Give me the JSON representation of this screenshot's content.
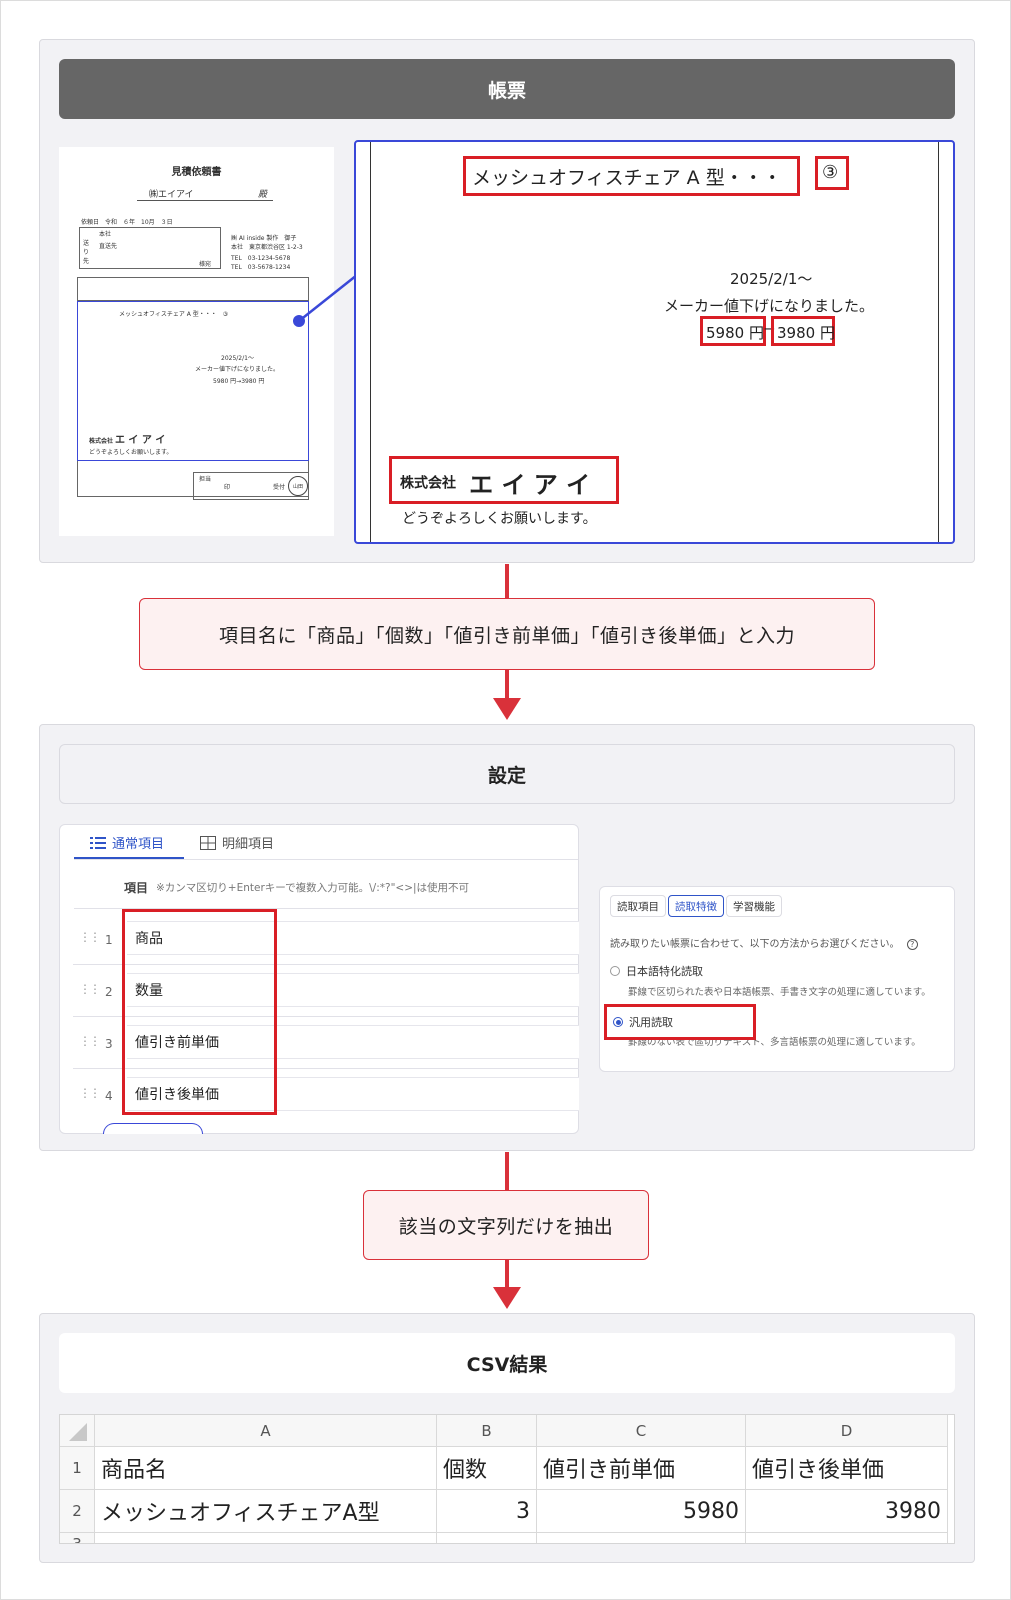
{
  "document_panel": {
    "title": "帳票",
    "thumbnail": {
      "title": "見積依頼書",
      "customer": "㈱エイアイ",
      "honorific": "殿",
      "date_line": "依頼日　令和　６年　10月　３日",
      "addr1": "本社",
      "addr2": "直送先",
      "addr_label": "送り先",
      "sama": "様宛",
      "sender_company": "㈱ AI inside 製作　御子",
      "sender_addr": "本社　東京都渋谷区 1-2-3",
      "tel1": "TEL　03-1234-5678",
      "tel2": "TEL　03-5678-1234",
      "item": "メッシュオフィスチェア A 型・・・　③",
      "date": "2025/2/1〜",
      "notice": "メーカー値下げになりました。",
      "price": "5980 円→3980 円",
      "company_prefix": "株式会社",
      "company_name": "エ イ ア イ",
      "closing": "どうぞよろしくお願いします。",
      "stamp_cells": [
        "担当",
        "印",
        "受付",
        "山田"
      ]
    },
    "zoom": {
      "item": "メッシュオフィスチェア A 型・・・",
      "qty": "③",
      "date": "2025/2/1〜",
      "notice": "メーカー値下げになりました。",
      "price_before": "5980 円",
      "price_after": "3980 円",
      "arrow": "→",
      "company_prefix": "株式会社",
      "company_name": "エ イ ア イ",
      "closing": "どうぞよろしくお願いします。"
    }
  },
  "step1": "項目名に「商品」「個数」「値引き前単価」「値引き後単価」と入力",
  "settings_panel": {
    "title": "設定",
    "tabs": [
      {
        "label": "通常項目",
        "active": true
      },
      {
        "label": "明細項目",
        "active": false
      }
    ],
    "column_header": "項目",
    "column_note": "※カンマ区切り+Enterキーで複数入力可能。\\/:*?\"<>|は使用不可",
    "rows": [
      {
        "num": "1",
        "value": "商品"
      },
      {
        "num": "2",
        "value": "数量"
      },
      {
        "num": "3",
        "value": "値引き前単価"
      },
      {
        "num": "4",
        "value": "値引き後単価"
      }
    ],
    "reading": {
      "tabs": [
        "読取項目",
        "読取特徴",
        "学習機能"
      ],
      "active_tab": "読取特徴",
      "instruction": "読み取りたい帳票に合わせて、以下の方法からお選びください。",
      "help_icon": "?",
      "options": [
        {
          "label": "日本語特化読取",
          "desc": "罫線で区切られた表や日本語帳票、手書き文字の処理に適しています。",
          "selected": false
        },
        {
          "label": "汎用読取",
          "desc": "罫線のない表で區切りテキスト、多言語帳票の処理に適しています。",
          "selected": true
        }
      ]
    }
  },
  "step2": "該当の文字列だけを抽出",
  "csv_panel": {
    "title": "CSV結果",
    "columns": [
      "A",
      "B",
      "C",
      "D"
    ],
    "row_numbers": [
      "1",
      "2",
      "3"
    ],
    "rows": [
      [
        "商品名",
        "個数",
        "値引き前単価",
        "値引き後単価"
      ],
      [
        "メッシュオフィスチェアA型",
        "3",
        "5980",
        "3980"
      ]
    ]
  },
  "colors": {
    "accent_red": "#d9313a",
    "highlight_blue": "#3a48d8",
    "tab_blue": "#2f54c8",
    "header_dark": "#666666"
  }
}
